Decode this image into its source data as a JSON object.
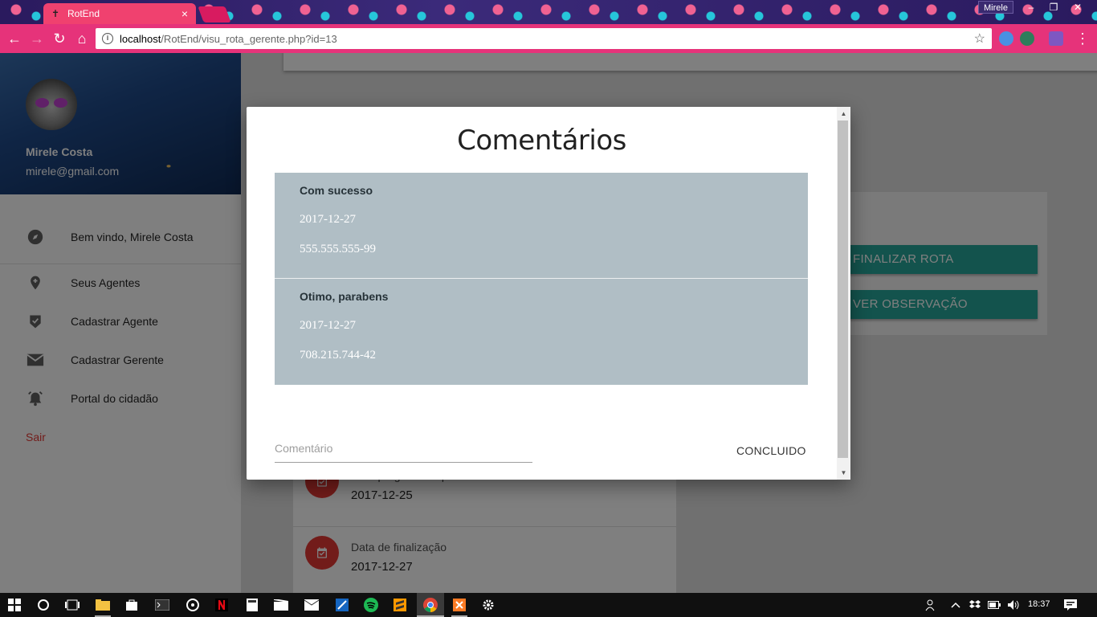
{
  "browser": {
    "tab_title": "RotEnd",
    "tab_close": "×",
    "window_user": "Mirele",
    "url_host": "localhost",
    "url_path": "/RotEnd/visu_rota_gerente.php?id=13",
    "info_glyph": "i",
    "bookmark_glyph": "☆",
    "minimize_glyph": "–",
    "restore_glyph": "❐",
    "close_glyph": "✕",
    "back_glyph": "←",
    "forward_glyph": "→",
    "reload_glyph": "↻",
    "home_glyph": "⌂",
    "colors": {
      "tab": "#f0416f",
      "toolbar": "#e6337a"
    }
  },
  "sidebar": {
    "user_name": "Mirele Costa",
    "user_email": "mirele@gmail.com",
    "items": [
      {
        "label": "Bem vindo, Mirele Costa",
        "icon": "compass-icon"
      },
      {
        "label": "Seus Agentes",
        "icon": "map-pin-plus-icon"
      },
      {
        "label": "Cadastrar Agente",
        "icon": "shield-check-icon"
      },
      {
        "label": "Cadastrar Gerente",
        "icon": "mail-icon"
      },
      {
        "label": "Portal do cidadão",
        "icon": "alarm-icon"
      }
    ],
    "logout": "Sair",
    "logout_color": "#e53935"
  },
  "actions": {
    "finalize_label": "FINALIZAR ROTA",
    "observation_label": "VER OBSERVAÇÃO",
    "color": "#26a69a"
  },
  "route_info": [
    {
      "label": "Data programada para finalizar:",
      "value": "2017-12-25",
      "icon": "calendar-check-icon"
    },
    {
      "label": "Data de finalização",
      "value": "2017-12-27",
      "icon": "calendar-check-icon"
    }
  ],
  "modal": {
    "title": "Comentários",
    "comments": [
      {
        "text": "Com sucesso",
        "date": "2017-12-27",
        "cpf": "555.555.555-99"
      },
      {
        "text": "Otimo, parabens",
        "date": "2017-12-27",
        "cpf": "708.215.744-42"
      }
    ],
    "comment_placeholder": "Comentário",
    "comment_value": "",
    "done_label": "CONCLUIDO",
    "scroll_up": "▲",
    "scroll_down": "▼"
  },
  "taskbar": {
    "time": "18:37",
    "icons": [
      "windows-start-icon",
      "search-icon",
      "task-view-icon",
      "file-explorer-icon",
      "store-icon",
      "terminal-icon",
      "media-icon",
      "netflix-icon",
      "calculator-icon",
      "video-editor-icon",
      "mail-icon",
      "tool-icon",
      "spotify-icon",
      "sublime-icon",
      "chrome-icon",
      "xampp-icon",
      "settings-icon"
    ]
  }
}
